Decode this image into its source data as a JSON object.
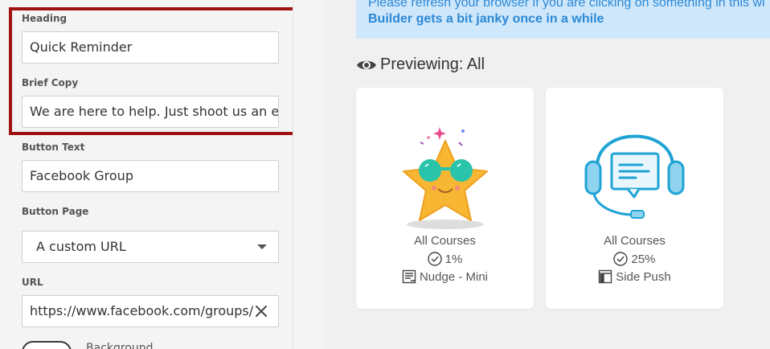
{
  "form": {
    "heading_label": "Heading",
    "heading_value": "Quick Reminder",
    "brief_copy_label": "Brief Copy",
    "brief_copy_value": "We are here to help. Just shoot us an em",
    "button_text_label": "Button Text",
    "button_text_value": "Facebook Group",
    "button_page_label": "Button Page",
    "button_page_value": "A custom URL",
    "url_label": "URL",
    "url_value": "https://www.facebook.com/groups/",
    "background_label": "Background"
  },
  "notice": {
    "line1": "Please refresh your browser if you are clicking on something in this wi",
    "line2": "Builder gets a bit janky once in a while"
  },
  "preview": {
    "title": "Previewing: All",
    "cards": [
      {
        "audience": "All Courses",
        "percent": "1%",
        "type": "Nudge - Mini",
        "icon": "star-sunglasses-illustration",
        "type_icon": "nudge-icon"
      },
      {
        "audience": "All Courses",
        "percent": "25%",
        "type": "Side Push",
        "icon": "headset-support-illustration",
        "type_icon": "side-push-icon"
      }
    ]
  },
  "colors": {
    "highlight": "#a0120f",
    "notice_bg": "#cfe7fb",
    "notice_text": "#2c89d6",
    "star": "#f7b733",
    "glasses": "#29c4a9",
    "headset": "#1fa3d4"
  }
}
